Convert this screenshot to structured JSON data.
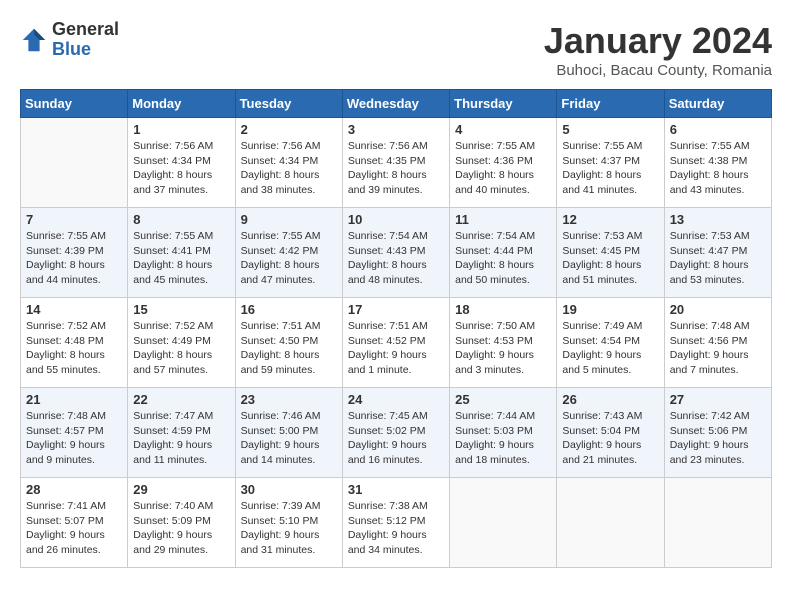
{
  "header": {
    "logo_general": "General",
    "logo_blue": "Blue",
    "title": "January 2024",
    "location": "Buhoci, Bacau County, Romania"
  },
  "days_of_week": [
    "Sunday",
    "Monday",
    "Tuesday",
    "Wednesday",
    "Thursday",
    "Friday",
    "Saturday"
  ],
  "weeks": [
    [
      {
        "day": "",
        "sunrise": "",
        "sunset": "",
        "daylight": ""
      },
      {
        "day": "1",
        "sunrise": "Sunrise: 7:56 AM",
        "sunset": "Sunset: 4:34 PM",
        "daylight": "Daylight: 8 hours and 37 minutes."
      },
      {
        "day": "2",
        "sunrise": "Sunrise: 7:56 AM",
        "sunset": "Sunset: 4:34 PM",
        "daylight": "Daylight: 8 hours and 38 minutes."
      },
      {
        "day": "3",
        "sunrise": "Sunrise: 7:56 AM",
        "sunset": "Sunset: 4:35 PM",
        "daylight": "Daylight: 8 hours and 39 minutes."
      },
      {
        "day": "4",
        "sunrise": "Sunrise: 7:55 AM",
        "sunset": "Sunset: 4:36 PM",
        "daylight": "Daylight: 8 hours and 40 minutes."
      },
      {
        "day": "5",
        "sunrise": "Sunrise: 7:55 AM",
        "sunset": "Sunset: 4:37 PM",
        "daylight": "Daylight: 8 hours and 41 minutes."
      },
      {
        "day": "6",
        "sunrise": "Sunrise: 7:55 AM",
        "sunset": "Sunset: 4:38 PM",
        "daylight": "Daylight: 8 hours and 43 minutes."
      }
    ],
    [
      {
        "day": "7",
        "sunrise": "Sunrise: 7:55 AM",
        "sunset": "Sunset: 4:39 PM",
        "daylight": "Daylight: 8 hours and 44 minutes."
      },
      {
        "day": "8",
        "sunrise": "Sunrise: 7:55 AM",
        "sunset": "Sunset: 4:41 PM",
        "daylight": "Daylight: 8 hours and 45 minutes."
      },
      {
        "day": "9",
        "sunrise": "Sunrise: 7:55 AM",
        "sunset": "Sunset: 4:42 PM",
        "daylight": "Daylight: 8 hours and 47 minutes."
      },
      {
        "day": "10",
        "sunrise": "Sunrise: 7:54 AM",
        "sunset": "Sunset: 4:43 PM",
        "daylight": "Daylight: 8 hours and 48 minutes."
      },
      {
        "day": "11",
        "sunrise": "Sunrise: 7:54 AM",
        "sunset": "Sunset: 4:44 PM",
        "daylight": "Daylight: 8 hours and 50 minutes."
      },
      {
        "day": "12",
        "sunrise": "Sunrise: 7:53 AM",
        "sunset": "Sunset: 4:45 PM",
        "daylight": "Daylight: 8 hours and 51 minutes."
      },
      {
        "day": "13",
        "sunrise": "Sunrise: 7:53 AM",
        "sunset": "Sunset: 4:47 PM",
        "daylight": "Daylight: 8 hours and 53 minutes."
      }
    ],
    [
      {
        "day": "14",
        "sunrise": "Sunrise: 7:52 AM",
        "sunset": "Sunset: 4:48 PM",
        "daylight": "Daylight: 8 hours and 55 minutes."
      },
      {
        "day": "15",
        "sunrise": "Sunrise: 7:52 AM",
        "sunset": "Sunset: 4:49 PM",
        "daylight": "Daylight: 8 hours and 57 minutes."
      },
      {
        "day": "16",
        "sunrise": "Sunrise: 7:51 AM",
        "sunset": "Sunset: 4:50 PM",
        "daylight": "Daylight: 8 hours and 59 minutes."
      },
      {
        "day": "17",
        "sunrise": "Sunrise: 7:51 AM",
        "sunset": "Sunset: 4:52 PM",
        "daylight": "Daylight: 9 hours and 1 minute."
      },
      {
        "day": "18",
        "sunrise": "Sunrise: 7:50 AM",
        "sunset": "Sunset: 4:53 PM",
        "daylight": "Daylight: 9 hours and 3 minutes."
      },
      {
        "day": "19",
        "sunrise": "Sunrise: 7:49 AM",
        "sunset": "Sunset: 4:54 PM",
        "daylight": "Daylight: 9 hours and 5 minutes."
      },
      {
        "day": "20",
        "sunrise": "Sunrise: 7:48 AM",
        "sunset": "Sunset: 4:56 PM",
        "daylight": "Daylight: 9 hours and 7 minutes."
      }
    ],
    [
      {
        "day": "21",
        "sunrise": "Sunrise: 7:48 AM",
        "sunset": "Sunset: 4:57 PM",
        "daylight": "Daylight: 9 hours and 9 minutes."
      },
      {
        "day": "22",
        "sunrise": "Sunrise: 7:47 AM",
        "sunset": "Sunset: 4:59 PM",
        "daylight": "Daylight: 9 hours and 11 minutes."
      },
      {
        "day": "23",
        "sunrise": "Sunrise: 7:46 AM",
        "sunset": "Sunset: 5:00 PM",
        "daylight": "Daylight: 9 hours and 14 minutes."
      },
      {
        "day": "24",
        "sunrise": "Sunrise: 7:45 AM",
        "sunset": "Sunset: 5:02 PM",
        "daylight": "Daylight: 9 hours and 16 minutes."
      },
      {
        "day": "25",
        "sunrise": "Sunrise: 7:44 AM",
        "sunset": "Sunset: 5:03 PM",
        "daylight": "Daylight: 9 hours and 18 minutes."
      },
      {
        "day": "26",
        "sunrise": "Sunrise: 7:43 AM",
        "sunset": "Sunset: 5:04 PM",
        "daylight": "Daylight: 9 hours and 21 minutes."
      },
      {
        "day": "27",
        "sunrise": "Sunrise: 7:42 AM",
        "sunset": "Sunset: 5:06 PM",
        "daylight": "Daylight: 9 hours and 23 minutes."
      }
    ],
    [
      {
        "day": "28",
        "sunrise": "Sunrise: 7:41 AM",
        "sunset": "Sunset: 5:07 PM",
        "daylight": "Daylight: 9 hours and 26 minutes."
      },
      {
        "day": "29",
        "sunrise": "Sunrise: 7:40 AM",
        "sunset": "Sunset: 5:09 PM",
        "daylight": "Daylight: 9 hours and 29 minutes."
      },
      {
        "day": "30",
        "sunrise": "Sunrise: 7:39 AM",
        "sunset": "Sunset: 5:10 PM",
        "daylight": "Daylight: 9 hours and 31 minutes."
      },
      {
        "day": "31",
        "sunrise": "Sunrise: 7:38 AM",
        "sunset": "Sunset: 5:12 PM",
        "daylight": "Daylight: 9 hours and 34 minutes."
      },
      {
        "day": "",
        "sunrise": "",
        "sunset": "",
        "daylight": ""
      },
      {
        "day": "",
        "sunrise": "",
        "sunset": "",
        "daylight": ""
      },
      {
        "day": "",
        "sunrise": "",
        "sunset": "",
        "daylight": ""
      }
    ]
  ]
}
